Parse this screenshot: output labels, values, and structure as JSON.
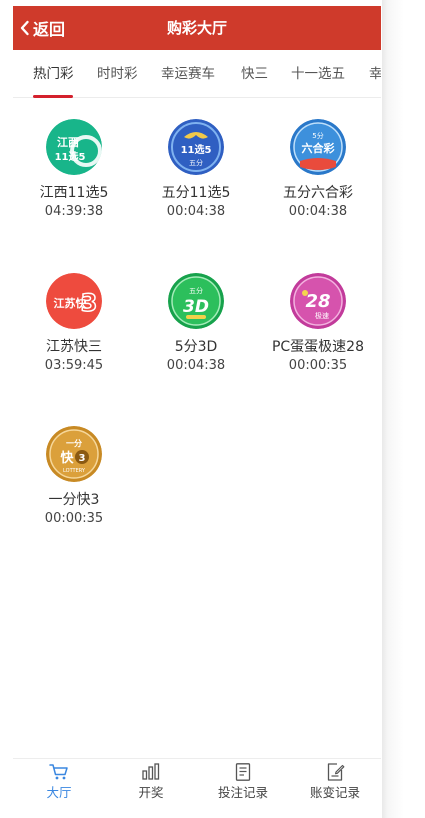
{
  "header": {
    "back_label": "返回",
    "title": "购彩大厅"
  },
  "tabs": [
    {
      "label": "热门彩",
      "active": true
    },
    {
      "label": "时时彩",
      "active": false
    },
    {
      "label": "幸运赛车",
      "active": false
    },
    {
      "label": "快三",
      "active": false
    },
    {
      "label": "十一选五",
      "active": false
    },
    {
      "label": "幸",
      "active": false
    }
  ],
  "games": [
    {
      "name": "江西11选5",
      "countdown": "04:39:38",
      "logo_text": [
        "江西",
        "11选5"
      ]
    },
    {
      "name": "五分11选5",
      "countdown": "00:04:38",
      "logo_text": [
        "11选5",
        "五分"
      ]
    },
    {
      "name": "五分六合彩",
      "countdown": "00:04:38",
      "logo_text": [
        "5分",
        "六合彩"
      ]
    },
    {
      "name": "江苏快三",
      "countdown": "03:59:45",
      "logo_text": [
        "江苏快",
        "3"
      ]
    },
    {
      "name": "5分3D",
      "countdown": "00:04:38",
      "logo_text": [
        "五分",
        "3D"
      ]
    },
    {
      "name": "PC蛋蛋极速28",
      "countdown": "00:00:35",
      "logo_text": [
        "28",
        "极速"
      ]
    },
    {
      "name": "一分快3",
      "countdown": "00:00:35",
      "logo_text": [
        "一分",
        "快",
        "3",
        "LOTTERY"
      ]
    }
  ],
  "bottom_nav": [
    {
      "label": "大厅",
      "icon": "cart-icon",
      "active": true
    },
    {
      "label": "开奖",
      "icon": "bar-chart-icon",
      "active": false
    },
    {
      "label": "投注记录",
      "icon": "document-icon",
      "active": false
    },
    {
      "label": "账变记录",
      "icon": "edit-document-icon",
      "active": false
    }
  ],
  "colors": {
    "header": "#cf3a2b",
    "indicator": "#d4202c",
    "nav_active": "#3a87e0"
  }
}
